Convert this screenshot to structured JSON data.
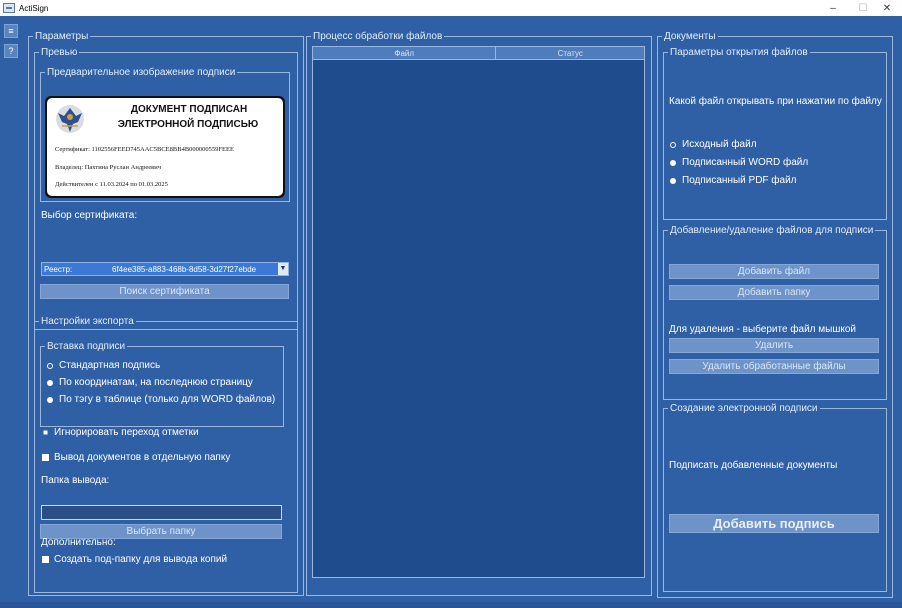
{
  "window": {
    "title": "ActiSign",
    "min_label": "–",
    "max_label": "☐",
    "close_label": "✕"
  },
  "side": {
    "btn1": "≡",
    "btn2": "?"
  },
  "params": {
    "legend": "Параметры",
    "preview": {
      "legend": "Превью",
      "sub_legend": "Предварительное изображение подписи",
      "card": {
        "line1": "ДОКУМЕНТ ПОДПИСАН",
        "line2": "ЭЛЕКТРОННОЙ ПОДПИСЬЮ",
        "cert": "Сертификат: 1102556FEED745AAC5BCE8BB4B000000559FEEE",
        "owner": "Владелец: Пахтина Руслан Андреевич",
        "valid": "Действителен с 11.03.2024 по 01.03.2025"
      },
      "cert_label": "Выбор сертификата:",
      "cert_select_1": "Реестр:",
      "cert_select_2": "6f4ee385-a883-468b-8d58-3d27f27ebde",
      "find_button": "Поиск сертификата"
    },
    "export": {
      "legend": "Настройки экспорта",
      "insert": {
        "legend": "Вставка подписи",
        "options": [
          "Стандартная подпись",
          "По координатам, на последнюю страницу",
          "По тэгу в таблице (только для WORD файлов)"
        ]
      },
      "ignore_label": "Игнорировать переход отметки",
      "separate_label": "Вывод документов в отдельную папку",
      "output_label": "Папка вывода:",
      "choose_button": "Выбрать папку",
      "extra_label": "Дополнительно:",
      "subfolder_label": "Создать под-папку для вывода копий"
    }
  },
  "process": {
    "legend": "Процесс обработки файлов",
    "columns": [
      "Файл",
      "Статус"
    ]
  },
  "docs": {
    "legend": "Документы",
    "open": {
      "legend": "Параметры открытия файлов",
      "question": "Какой файл открывать при нажатии по файлу",
      "options": [
        "Исходный файл",
        "Подписанный WORD файл",
        "Подписанный PDF файл"
      ]
    },
    "manage": {
      "legend": "Добавление/удаление файлов для подписи",
      "add_file": "Добавить файл",
      "add_folder": "Добавить папку",
      "delete_hint": "Для удаления - выберите файл мышкой",
      "delete": "Удалить",
      "delete_processed": "Удалить обработанные файлы"
    },
    "create": {
      "legend": "Создание электронной подписи",
      "sign_label": "Подписать добавленные документы",
      "sign_button": "Добавить подпись"
    }
  }
}
